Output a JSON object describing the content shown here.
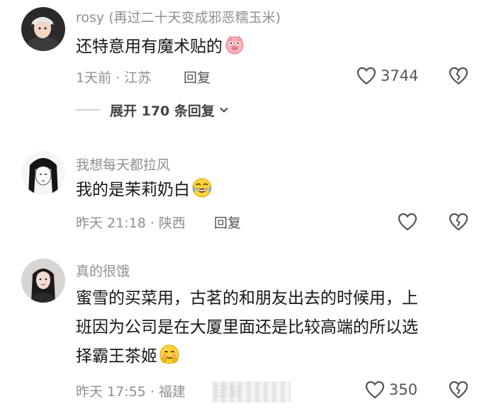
{
  "comments": [
    {
      "name": "rosy",
      "name_extra": "(再过二十天变成邪恶糯玉米)",
      "text": "还特意用有魔术贴的",
      "emoji": "pig-face-emoji",
      "time": "1天前",
      "location": "江苏",
      "reply_label": "回复",
      "likes": "3744"
    },
    {
      "name": "我想每天都拉风",
      "text": "我的是茉莉奶白",
      "emoji": "laughing-tears-emoji",
      "time": "昨天 21:18",
      "location": "陕西",
      "reply_label": "回复",
      "likes": ""
    },
    {
      "name": "真的很饿",
      "text_lines": [
        "蜜雪的买菜用，古茗的和朋友出去的时候用，上",
        "班因为公司是在大厦里面还是比较高端的所以选",
        "择霸王茶姬"
      ],
      "emoji": "shy-smile-emoji",
      "time": "昨天 17:55",
      "location": "福建",
      "reply_label": "回复",
      "likes": "350"
    }
  ],
  "expand": {
    "label": "展开 170 条回复"
  },
  "separator": " · ",
  "colors": {
    "text": "#161616",
    "meta": "#8f8f8f",
    "icon": "#555555"
  }
}
